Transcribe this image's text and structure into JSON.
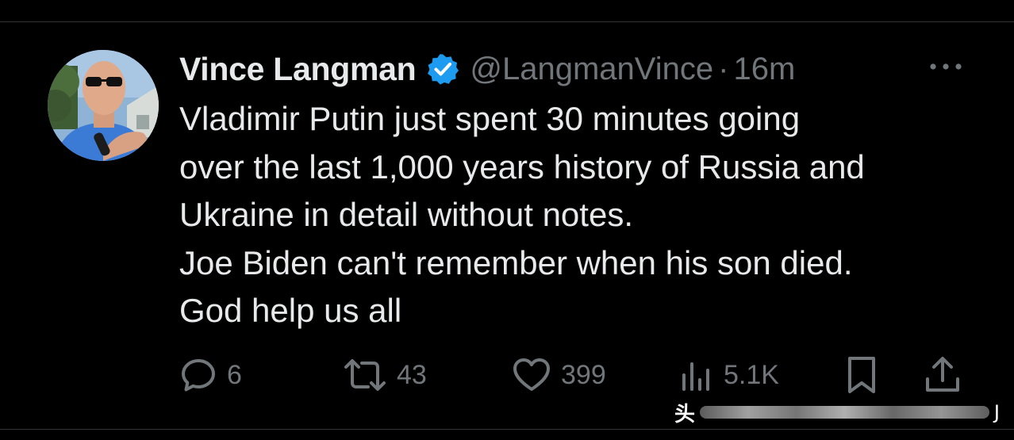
{
  "tweet": {
    "author_name": "Vince Langman",
    "handle": "@LangmanVince",
    "separator": "·",
    "time": "16m",
    "verified": true,
    "avatar_icon": "user-avatar-photo",
    "more_icon": "more-horizontal-icon",
    "text_lines": [
      "Vladimir Putin just spent 30 minutes going",
      "over the last 1,000 years history of Russia and",
      "Ukraine in detail without notes.",
      "Joe Biden can't remember when his son died.",
      "God help us all"
    ],
    "actions": {
      "reply": {
        "icon": "reply-icon",
        "count": "6"
      },
      "retweet": {
        "icon": "retweet-icon",
        "count": "43"
      },
      "like": {
        "icon": "heart-icon",
        "count": "399"
      },
      "views": {
        "icon": "views-chart-icon",
        "count": "5.1K"
      },
      "bookmark": {
        "icon": "bookmark-icon"
      },
      "share": {
        "icon": "share-icon"
      }
    }
  },
  "watermark": {
    "prefix": "头",
    "suffix": "J"
  },
  "colors": {
    "background": "#000000",
    "primary_text": "#e7e9ea",
    "secondary_text": "#71767b",
    "verified_badge": "#1d9bf0",
    "divider": "#2f3336"
  }
}
